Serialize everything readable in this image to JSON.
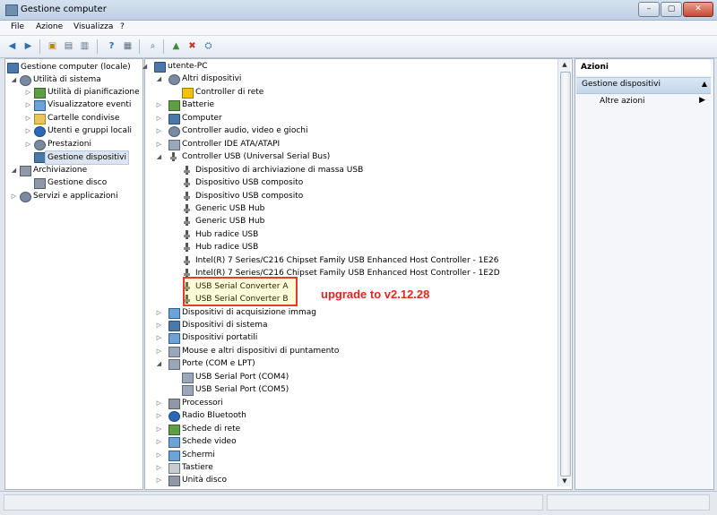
{
  "window": {
    "title": "Gestione computer"
  },
  "menu": [
    "File",
    "Azione",
    "Visualizza",
    "?"
  ],
  "left_tree": [
    {
      "label": "Gestione computer (locale)",
      "icon": "computer-management-icon"
    },
    {
      "label": "Utilità di sistema",
      "icon": "tools-icon"
    },
    {
      "label": "Utilità di pianificazione",
      "icon": "scheduler-icon"
    },
    {
      "label": "Visualizzatore eventi",
      "icon": "event-viewer-icon"
    },
    {
      "label": "Cartelle condivise",
      "icon": "shared-folder-icon"
    },
    {
      "label": "Utenti e gruppi locali",
      "icon": "users-icon"
    },
    {
      "label": "Prestazioni",
      "icon": "performance-icon"
    },
    {
      "label": "Gestione dispositivi",
      "icon": "device-manager-icon"
    },
    {
      "label": "Archiviazione",
      "icon": "storage-icon"
    },
    {
      "label": "Gestione disco",
      "icon": "disk-icon"
    },
    {
      "label": "Servizi e applicazioni",
      "icon": "services-icon"
    }
  ],
  "device_tree": [
    {
      "label": "utente-PC",
      "icon": "computer-icon"
    },
    {
      "label": "Altri dispositivi",
      "icon": "unknown-device-icon"
    },
    {
      "label": "Controller di rete",
      "icon": "warning-icon"
    },
    {
      "label": "Batterie",
      "icon": "battery-icon"
    },
    {
      "label": "Computer",
      "icon": "computer-icon"
    },
    {
      "label": "Controller audio, video e giochi",
      "icon": "audio-icon"
    },
    {
      "label": "Controller IDE ATA/ATAPI",
      "icon": "ide-icon"
    },
    {
      "label": "Controller USB (Universal Serial Bus)",
      "icon": "usb-icon"
    },
    {
      "label": "Dispositivo di archiviazione di massa USB",
      "icon": "usb-icon"
    },
    {
      "label": "Dispositivo USB composito",
      "icon": "usb-icon"
    },
    {
      "label": "Dispositivo USB composito",
      "icon": "usb-icon"
    },
    {
      "label": "Generic USB Hub",
      "icon": "usb-icon"
    },
    {
      "label": "Generic USB Hub",
      "icon": "usb-icon"
    },
    {
      "label": "Hub radice USB",
      "icon": "usb-icon"
    },
    {
      "label": "Hub radice USB",
      "icon": "usb-icon"
    },
    {
      "label": "Intel(R) 7 Series/C216 Chipset Family USB Enhanced Host Controller - 1E26",
      "icon": "usb-icon"
    },
    {
      "label": "Intel(R) 7 Series/C216 Chipset Family USB Enhanced Host Controller - 1E2D",
      "icon": "usb-icon"
    },
    {
      "label": "USB Serial Converter A",
      "icon": "usb-icon"
    },
    {
      "label": "USB Serial Converter B",
      "icon": "usb-icon"
    },
    {
      "label": "Dispositivi di acquisizione immag",
      "icon": "camera-icon"
    },
    {
      "label": "Dispositivi di sistema",
      "icon": "system-device-icon"
    },
    {
      "label": "Dispositivi portatili",
      "icon": "portable-device-icon"
    },
    {
      "label": "Mouse e altri dispositivi di puntamento",
      "icon": "mouse-icon"
    },
    {
      "label": "Porte (COM e LPT)",
      "icon": "port-icon"
    },
    {
      "label": "USB Serial Port (COM4)",
      "icon": "port-icon"
    },
    {
      "label": "USB Serial Port (COM5)",
      "icon": "port-icon"
    },
    {
      "label": "Processori",
      "icon": "processor-icon"
    },
    {
      "label": "Radio Bluetooth",
      "icon": "bluetooth-icon"
    },
    {
      "label": "Schede di rete",
      "icon": "network-card-icon"
    },
    {
      "label": "Schede video",
      "icon": "display-adapter-icon"
    },
    {
      "label": "Schermi",
      "icon": "monitor-icon"
    },
    {
      "label": "Tastiere",
      "icon": "keyboard-icon"
    },
    {
      "label": "Unità disco",
      "icon": "disk-drive-icon"
    }
  ],
  "annotation": {
    "text": "upgrade to v2.12.28",
    "color": "#e0281d"
  },
  "actions": {
    "header": "Azioni",
    "section": "Gestione dispositivi",
    "more": "Altre azioni"
  }
}
